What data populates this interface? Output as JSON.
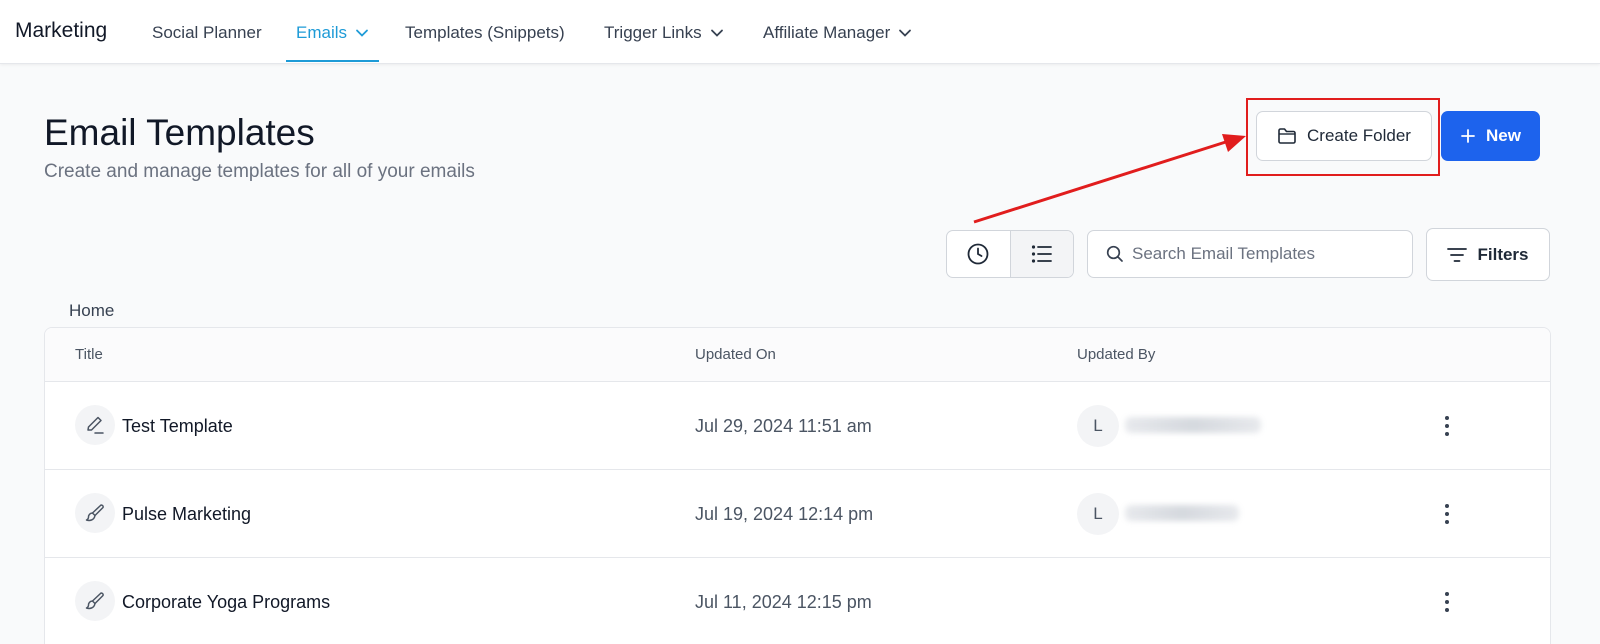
{
  "topnav": {
    "brand": "Marketing",
    "items": [
      {
        "label": "Social Planner",
        "has_dropdown": false,
        "active": false
      },
      {
        "label": "Emails",
        "has_dropdown": true,
        "active": true
      },
      {
        "label": "Templates (Snippets)",
        "has_dropdown": false,
        "active": false
      },
      {
        "label": "Trigger Links",
        "has_dropdown": true,
        "active": false
      },
      {
        "label": "Affiliate Manager",
        "has_dropdown": true,
        "active": false
      }
    ]
  },
  "header": {
    "title": "Email Templates",
    "subtitle": "Create and manage templates for all of your emails",
    "create_folder_label": "Create Folder",
    "new_label": "New"
  },
  "toolbar": {
    "search_placeholder": "Search Email Templates",
    "filters_label": "Filters"
  },
  "breadcrumb": "Home",
  "table": {
    "columns": [
      "Title",
      "Updated On",
      "Updated By"
    ],
    "rows": [
      {
        "title": "Test Template",
        "updated_on": "Jul 29, 2024 11:51 am",
        "avatar": "L",
        "icon": "pencil-edit-icon"
      },
      {
        "title": "Pulse Marketing",
        "updated_on": "Jul 19, 2024 12:14 pm",
        "avatar": "L",
        "icon": "brush-icon"
      },
      {
        "title": "Corporate Yoga Programs",
        "updated_on": "Jul 11, 2024 12:15 pm",
        "avatar": "",
        "icon": "brush-icon"
      }
    ]
  },
  "colors": {
    "accent": "#1e9bd7",
    "primary_button": "#1d63ed",
    "annotation_red": "#e11d1d"
  }
}
